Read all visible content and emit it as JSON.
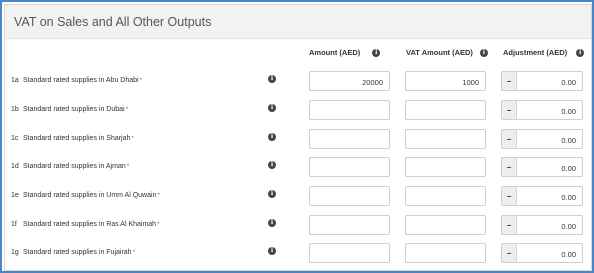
{
  "panel": {
    "title": "VAT on Sales and All Other Outputs"
  },
  "columns": {
    "amount": "Amount (AED)",
    "vat_amount": "VAT Amount (AED)",
    "adjustment": "Adjustment (AED)"
  },
  "icons": {
    "info": "info-icon",
    "info_glyph": "i"
  },
  "adjustment_sign": "−",
  "rows": [
    {
      "code": "1a",
      "label": "Standard rated supplies in Abu Dhabi",
      "required": "*",
      "amount": "20000",
      "vat_amount": "1000",
      "adjustment": "0.00"
    },
    {
      "code": "1b",
      "label": "Standard rated supplies in Dubai",
      "required": "*",
      "amount": "",
      "vat_amount": "",
      "adjustment": "0.00"
    },
    {
      "code": "1c",
      "label": "Standard rated supplies in Sharjah",
      "required": "*",
      "amount": "",
      "vat_amount": "",
      "adjustment": "0.00"
    },
    {
      "code": "1d",
      "label": "Standard rated supplies in Ajman",
      "required": "*",
      "amount": "",
      "vat_amount": "",
      "adjustment": "0.00"
    },
    {
      "code": "1e",
      "label": "Standard rated supplies in Umm Al Quwain",
      "required": "*",
      "amount": "",
      "vat_amount": "",
      "adjustment": "0.00"
    },
    {
      "code": "1f",
      "label": "Standard rated supplies in Ras Al Khaimah",
      "required": "*",
      "amount": "",
      "vat_amount": "",
      "adjustment": "0.00"
    },
    {
      "code": "1g",
      "label": "Standard rated supplies in Fujairah",
      "required": "*",
      "amount": "",
      "vat_amount": "",
      "adjustment": "0.00"
    }
  ]
}
